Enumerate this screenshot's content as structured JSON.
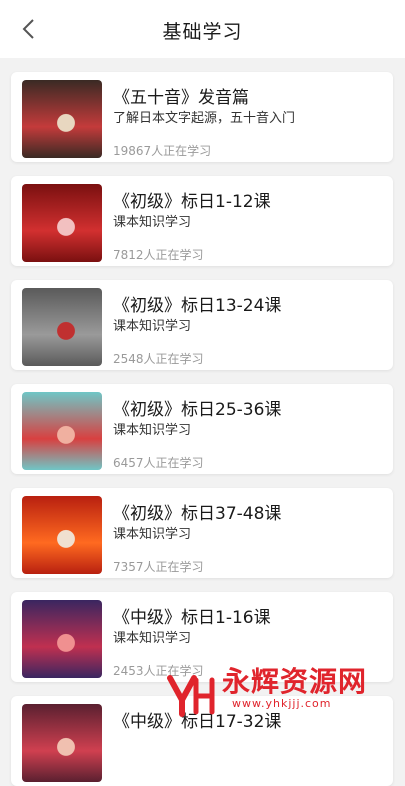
{
  "header": {
    "title": "基础学习",
    "back_icon": "chevron-left-icon"
  },
  "courses": [
    {
      "title": "《五十音》发音篇",
      "subtitle": "了解日本文字起源，五十音入门",
      "learners": "19867人正在学习",
      "thumb_colors": [
        "#3a2a24",
        "#c43b3b",
        "#e8d7c0"
      ]
    },
    {
      "title": "《初级》标日1-12课",
      "subtitle": "课本知识学习",
      "learners": "7812人正在学习",
      "thumb_colors": [
        "#7a1010",
        "#d23030",
        "#f2c0c0"
      ]
    },
    {
      "title": "《初级》标日13-24课",
      "subtitle": "课本知识学习",
      "learners": "2548人正在学习",
      "thumb_colors": [
        "#5a5a5a",
        "#9a9a9a",
        "#c03030"
      ]
    },
    {
      "title": "《初级》标日25-36课",
      "subtitle": "课本知识学习",
      "learners": "6457人正在学习",
      "thumb_colors": [
        "#6fc6c6",
        "#d84040",
        "#f0b0a0"
      ]
    },
    {
      "title": "《初级》标日37-48课",
      "subtitle": "课本知识学习",
      "learners": "7357人正在学习",
      "thumb_colors": [
        "#b82010",
        "#ff6a20",
        "#f0e0d0"
      ]
    },
    {
      "title": "《中级》标日1-16课",
      "subtitle": "课本知识学习",
      "learners": "2453人正在学习",
      "thumb_colors": [
        "#3a2660",
        "#c03050",
        "#f09090"
      ]
    },
    {
      "title": "《中级》标日17-32课",
      "subtitle": "",
      "learners": "",
      "thumb_colors": [
        "#5a2030",
        "#d04050",
        "#f0c0b0"
      ]
    }
  ],
  "watermark": {
    "text": "永辉资源网",
    "url_text": "www.yhkjjj.com",
    "brand_color": "#e0242c"
  }
}
